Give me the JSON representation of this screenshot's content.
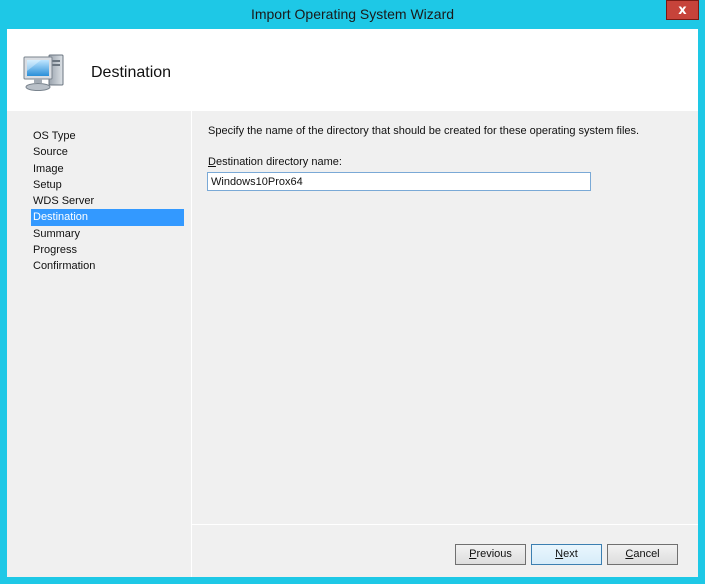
{
  "window": {
    "title": "Import Operating System Wizard",
    "close_label": "x"
  },
  "header": {
    "title": "Destination",
    "icon": "computer-icon"
  },
  "nav": {
    "items": [
      {
        "label": "OS Type",
        "active": false
      },
      {
        "label": "Source",
        "active": false
      },
      {
        "label": "Image",
        "active": false
      },
      {
        "label": "Setup",
        "active": false
      },
      {
        "label": "WDS Server",
        "active": false
      },
      {
        "label": "Destination",
        "active": true
      },
      {
        "label": "Summary",
        "active": false
      },
      {
        "label": "Progress",
        "active": false
      },
      {
        "label": "Confirmation",
        "active": false
      }
    ]
  },
  "main": {
    "description": "Specify the name of the directory that should be created for these operating system files.",
    "field_label_first": "D",
    "field_label_rest": "estination directory name:",
    "field_value": "Windows10Prox64"
  },
  "buttons": {
    "previous_first": "P",
    "previous_rest": "revious",
    "next_first": "N",
    "next_rest": "ext",
    "cancel_first": "C",
    "cancel_rest": "ancel"
  },
  "colors": {
    "frame": "#1ec8e6",
    "close": "#c7433a",
    "selection": "#3399ff"
  }
}
